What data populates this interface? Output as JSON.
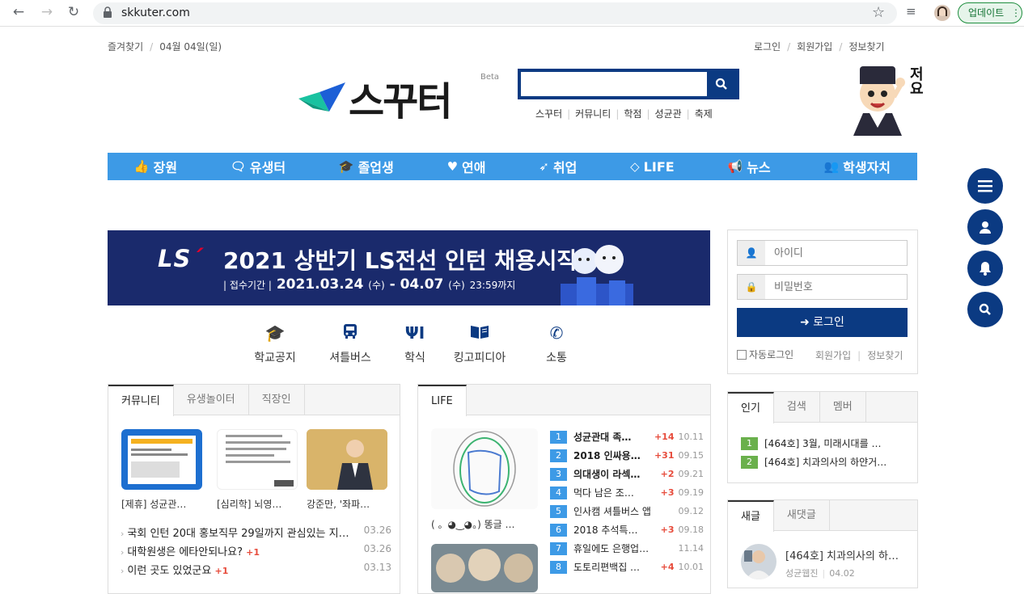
{
  "browser": {
    "url": "skkuter.com",
    "update_label": "업데이트"
  },
  "top": {
    "left": [
      "즐겨찾기",
      "04월 04일(일)"
    ],
    "right": [
      "로그인",
      "회원가입",
      "정보찾기"
    ]
  },
  "logo": {
    "text": "스꾸터",
    "beta": "Beta"
  },
  "search": {
    "placeholder": ""
  },
  "quick_links": [
    "스꾸터",
    "커뮤니티",
    "학점",
    "성균관",
    "축제"
  ],
  "mascot": {
    "text": "저요"
  },
  "nav": [
    {
      "icon": "thumbs-up-icon",
      "glyph": "👍",
      "label": "장원"
    },
    {
      "icon": "chat-icon",
      "glyph": "🗨",
      "label": "유생터"
    },
    {
      "icon": "graduation-cap-icon",
      "glyph": "🎓",
      "label": "졸업생"
    },
    {
      "icon": "heart-icon",
      "glyph": "♥",
      "label": "연애"
    },
    {
      "icon": "rocket-icon",
      "glyph": "➶",
      "label": "취업"
    },
    {
      "icon": "diamond-icon",
      "glyph": "◇",
      "label": "LIFE"
    },
    {
      "icon": "megaphone-icon",
      "glyph": "📢",
      "label": "뉴스"
    },
    {
      "icon": "users-icon",
      "glyph": "👥",
      "label": "학생자치"
    }
  ],
  "banner": {
    "logo_l": "LS",
    "title": "2021 상반기 LS전선 인턴 채용시작",
    "period_label": "| 접수기간 |",
    "period": "2021.03.24",
    "dow1": "(수)",
    "dash": " - ",
    "period_end": "04.07",
    "dow2": "(수)",
    "time": "23:59까지"
  },
  "quick_icons": [
    {
      "icon": "graduation-cap-icon",
      "label": "학교공지"
    },
    {
      "icon": "bus-icon",
      "label": "셔틀버스"
    },
    {
      "icon": "fork-knife-icon",
      "label": "학식"
    },
    {
      "icon": "book-icon",
      "label": "킹고피디아"
    },
    {
      "icon": "phone-icon",
      "label": "소통"
    }
  ],
  "login": {
    "id_placeholder": "아이디",
    "pw_placeholder": "비밀번호",
    "button": "로그인",
    "auto": "자동로그인",
    "join": "회원가입",
    "find": "정보찾기"
  },
  "community": {
    "tabs": [
      "커뮤니티",
      "유생놀이터",
      "직장인"
    ],
    "thumbs": [
      "[제휴] 성균관…",
      "[심리학] 뇌영…",
      "강준만, '좌파…"
    ],
    "rows": [
      {
        "title": "국회 인턴 20대 홍보직무 29일까지 관심있는 지…",
        "plus": "",
        "date": "03.26"
      },
      {
        "title": "대학원생은 에타안되나요?",
        "plus": "+1",
        "date": "03.26"
      },
      {
        "title": "이런 곳도 있었군요",
        "plus": "+1",
        "date": "03.13"
      }
    ]
  },
  "life": {
    "tab": "LIFE",
    "thumb_caption": "( 。◕‿◕。) 똥글 …",
    "rows": [
      {
        "rank": "1",
        "title": "성균관대 족…",
        "count": "+14",
        "date": "10.11",
        "bold": true
      },
      {
        "rank": "2",
        "title": "2018 인싸용…",
        "count": "+31",
        "date": "09.15",
        "bold": true
      },
      {
        "rank": "3",
        "title": "의대생이 라섹…",
        "count": "+2",
        "date": "09.21",
        "bold": true
      },
      {
        "rank": "4",
        "title": "먹다 남은 조…",
        "count": "+3",
        "date": "09.19",
        "bold": false
      },
      {
        "rank": "5",
        "title": "인사캠 셔틀버스 앱",
        "count": "",
        "date": "09.12",
        "bold": false
      },
      {
        "rank": "6",
        "title": "2018 추석특…",
        "count": "+3",
        "date": "09.18",
        "bold": false
      },
      {
        "rank": "7",
        "title": "휴일에도 은행업…",
        "count": "",
        "date": "11.14",
        "bold": false
      },
      {
        "rank": "8",
        "title": "도토리편백집 …",
        "count": "+4",
        "date": "10.01",
        "bold": false
      }
    ]
  },
  "popular": {
    "tabs": [
      "인기",
      "검색",
      "멤버"
    ],
    "rows": [
      {
        "rank": "1",
        "title": "[464호] 3월, 미래시대를 …"
      },
      {
        "rank": "2",
        "title": "[464호] 치과의사의 하얀거…"
      }
    ]
  },
  "newpost": {
    "tabs": [
      "새글",
      "새댓글"
    ],
    "title": "[464호] 치과의사의 하…",
    "author": "성균웹진",
    "date": "04.02"
  },
  "colors": {
    "brand": "#0b3a82",
    "nav": "#3d9ae6",
    "banner": "#1a2a6c"
  }
}
